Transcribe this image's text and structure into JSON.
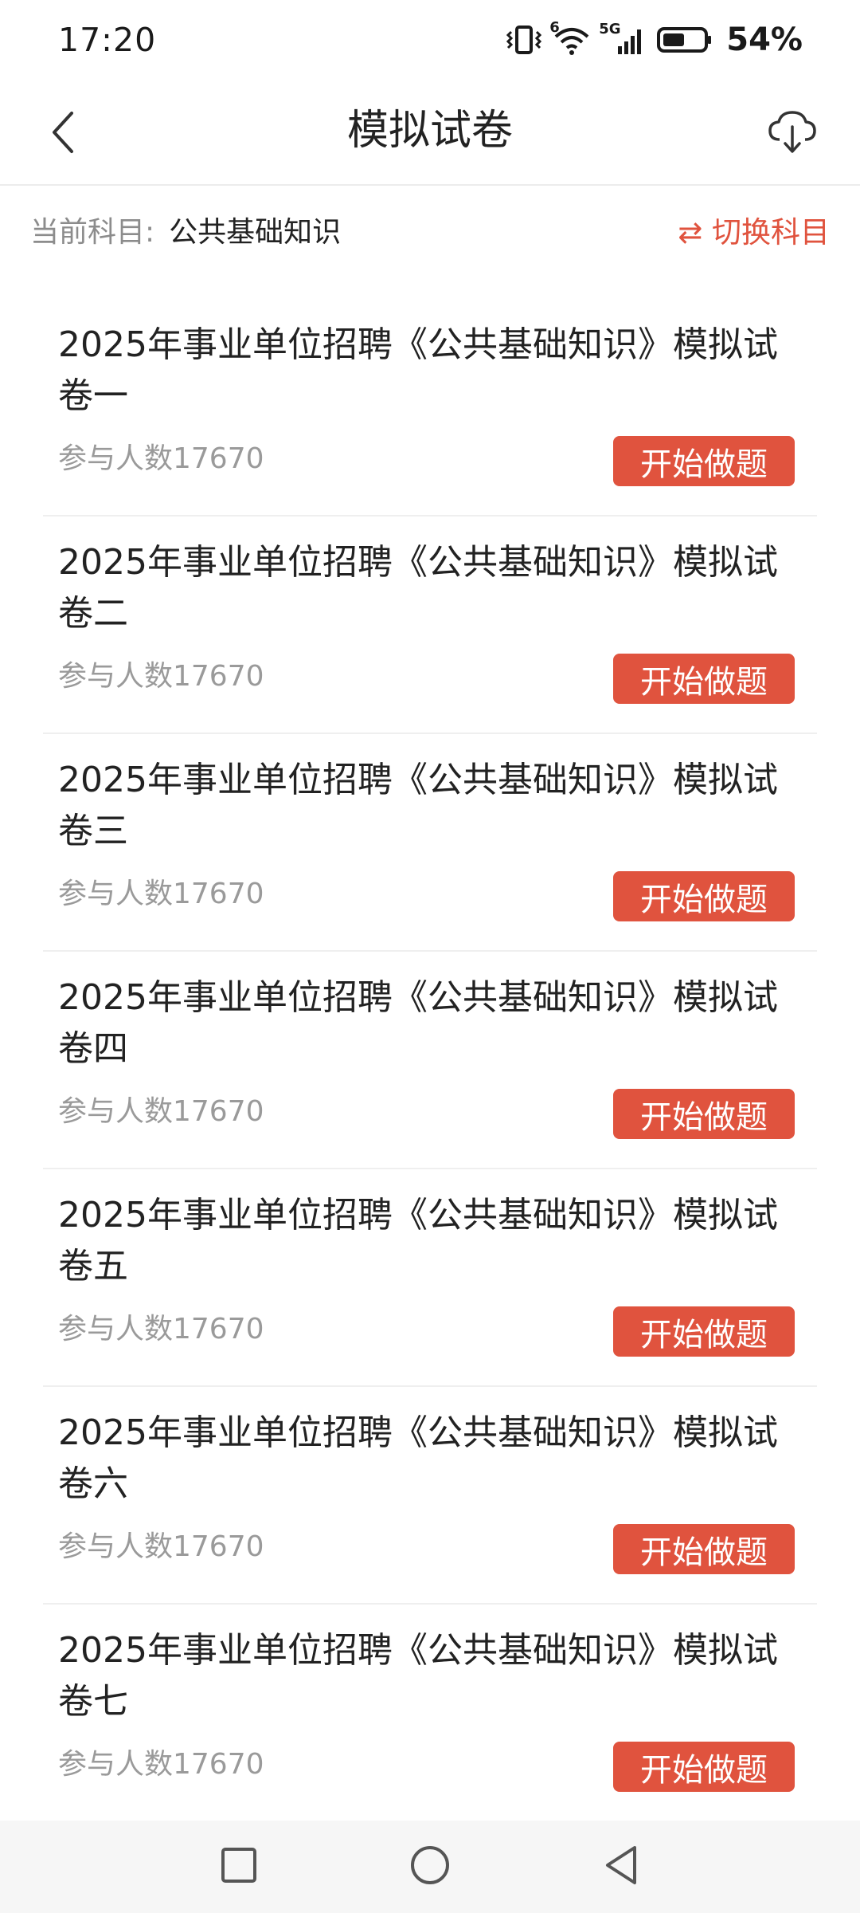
{
  "status_bar": {
    "time": "17:20",
    "network": "5G",
    "wifi_badge": "6",
    "battery": "54%",
    "icons": [
      "vibrate-icon",
      "wifi-icon",
      "signal-5g-icon",
      "battery-icon"
    ]
  },
  "header": {
    "title": "模拟试卷",
    "back_icon": "back-chevron-icon",
    "download_icon": "cloud-download-icon"
  },
  "subject_bar": {
    "label": "当前科目:",
    "value": "公共基础知识",
    "switch_label": "⇄ 切换科目"
  },
  "papers": [
    {
      "title": "2025年事业单位招聘《公共基础知识》模拟试卷一",
      "count": "参与人数17670",
      "button": "开始做题"
    },
    {
      "title": "2025年事业单位招聘《公共基础知识》模拟试卷二",
      "count": "参与人数17670",
      "button": "开始做题"
    },
    {
      "title": "2025年事业单位招聘《公共基础知识》模拟试卷三",
      "count": "参与人数17670",
      "button": "开始做题"
    },
    {
      "title": "2025年事业单位招聘《公共基础知识》模拟试卷四",
      "count": "参与人数17670",
      "button": "开始做题"
    },
    {
      "title": "2025年事业单位招聘《公共基础知识》模拟试卷五",
      "count": "参与人数17670",
      "button": "开始做题"
    },
    {
      "title": "2025年事业单位招聘《公共基础知识》模拟试卷六",
      "count": "参与人数17670",
      "button": "开始做题"
    },
    {
      "title": "2025年事业单位招聘《公共基础知识》模拟试卷七",
      "count": "参与人数17670",
      "button": "开始做题"
    }
  ],
  "colors": {
    "accent": "#e0533e",
    "text_primary": "#222222",
    "text_secondary": "#9a9a9a",
    "divider": "#efefef"
  },
  "nav_bar": {
    "icons": [
      "recents-square-icon",
      "home-circle-icon",
      "back-triangle-icon"
    ]
  }
}
